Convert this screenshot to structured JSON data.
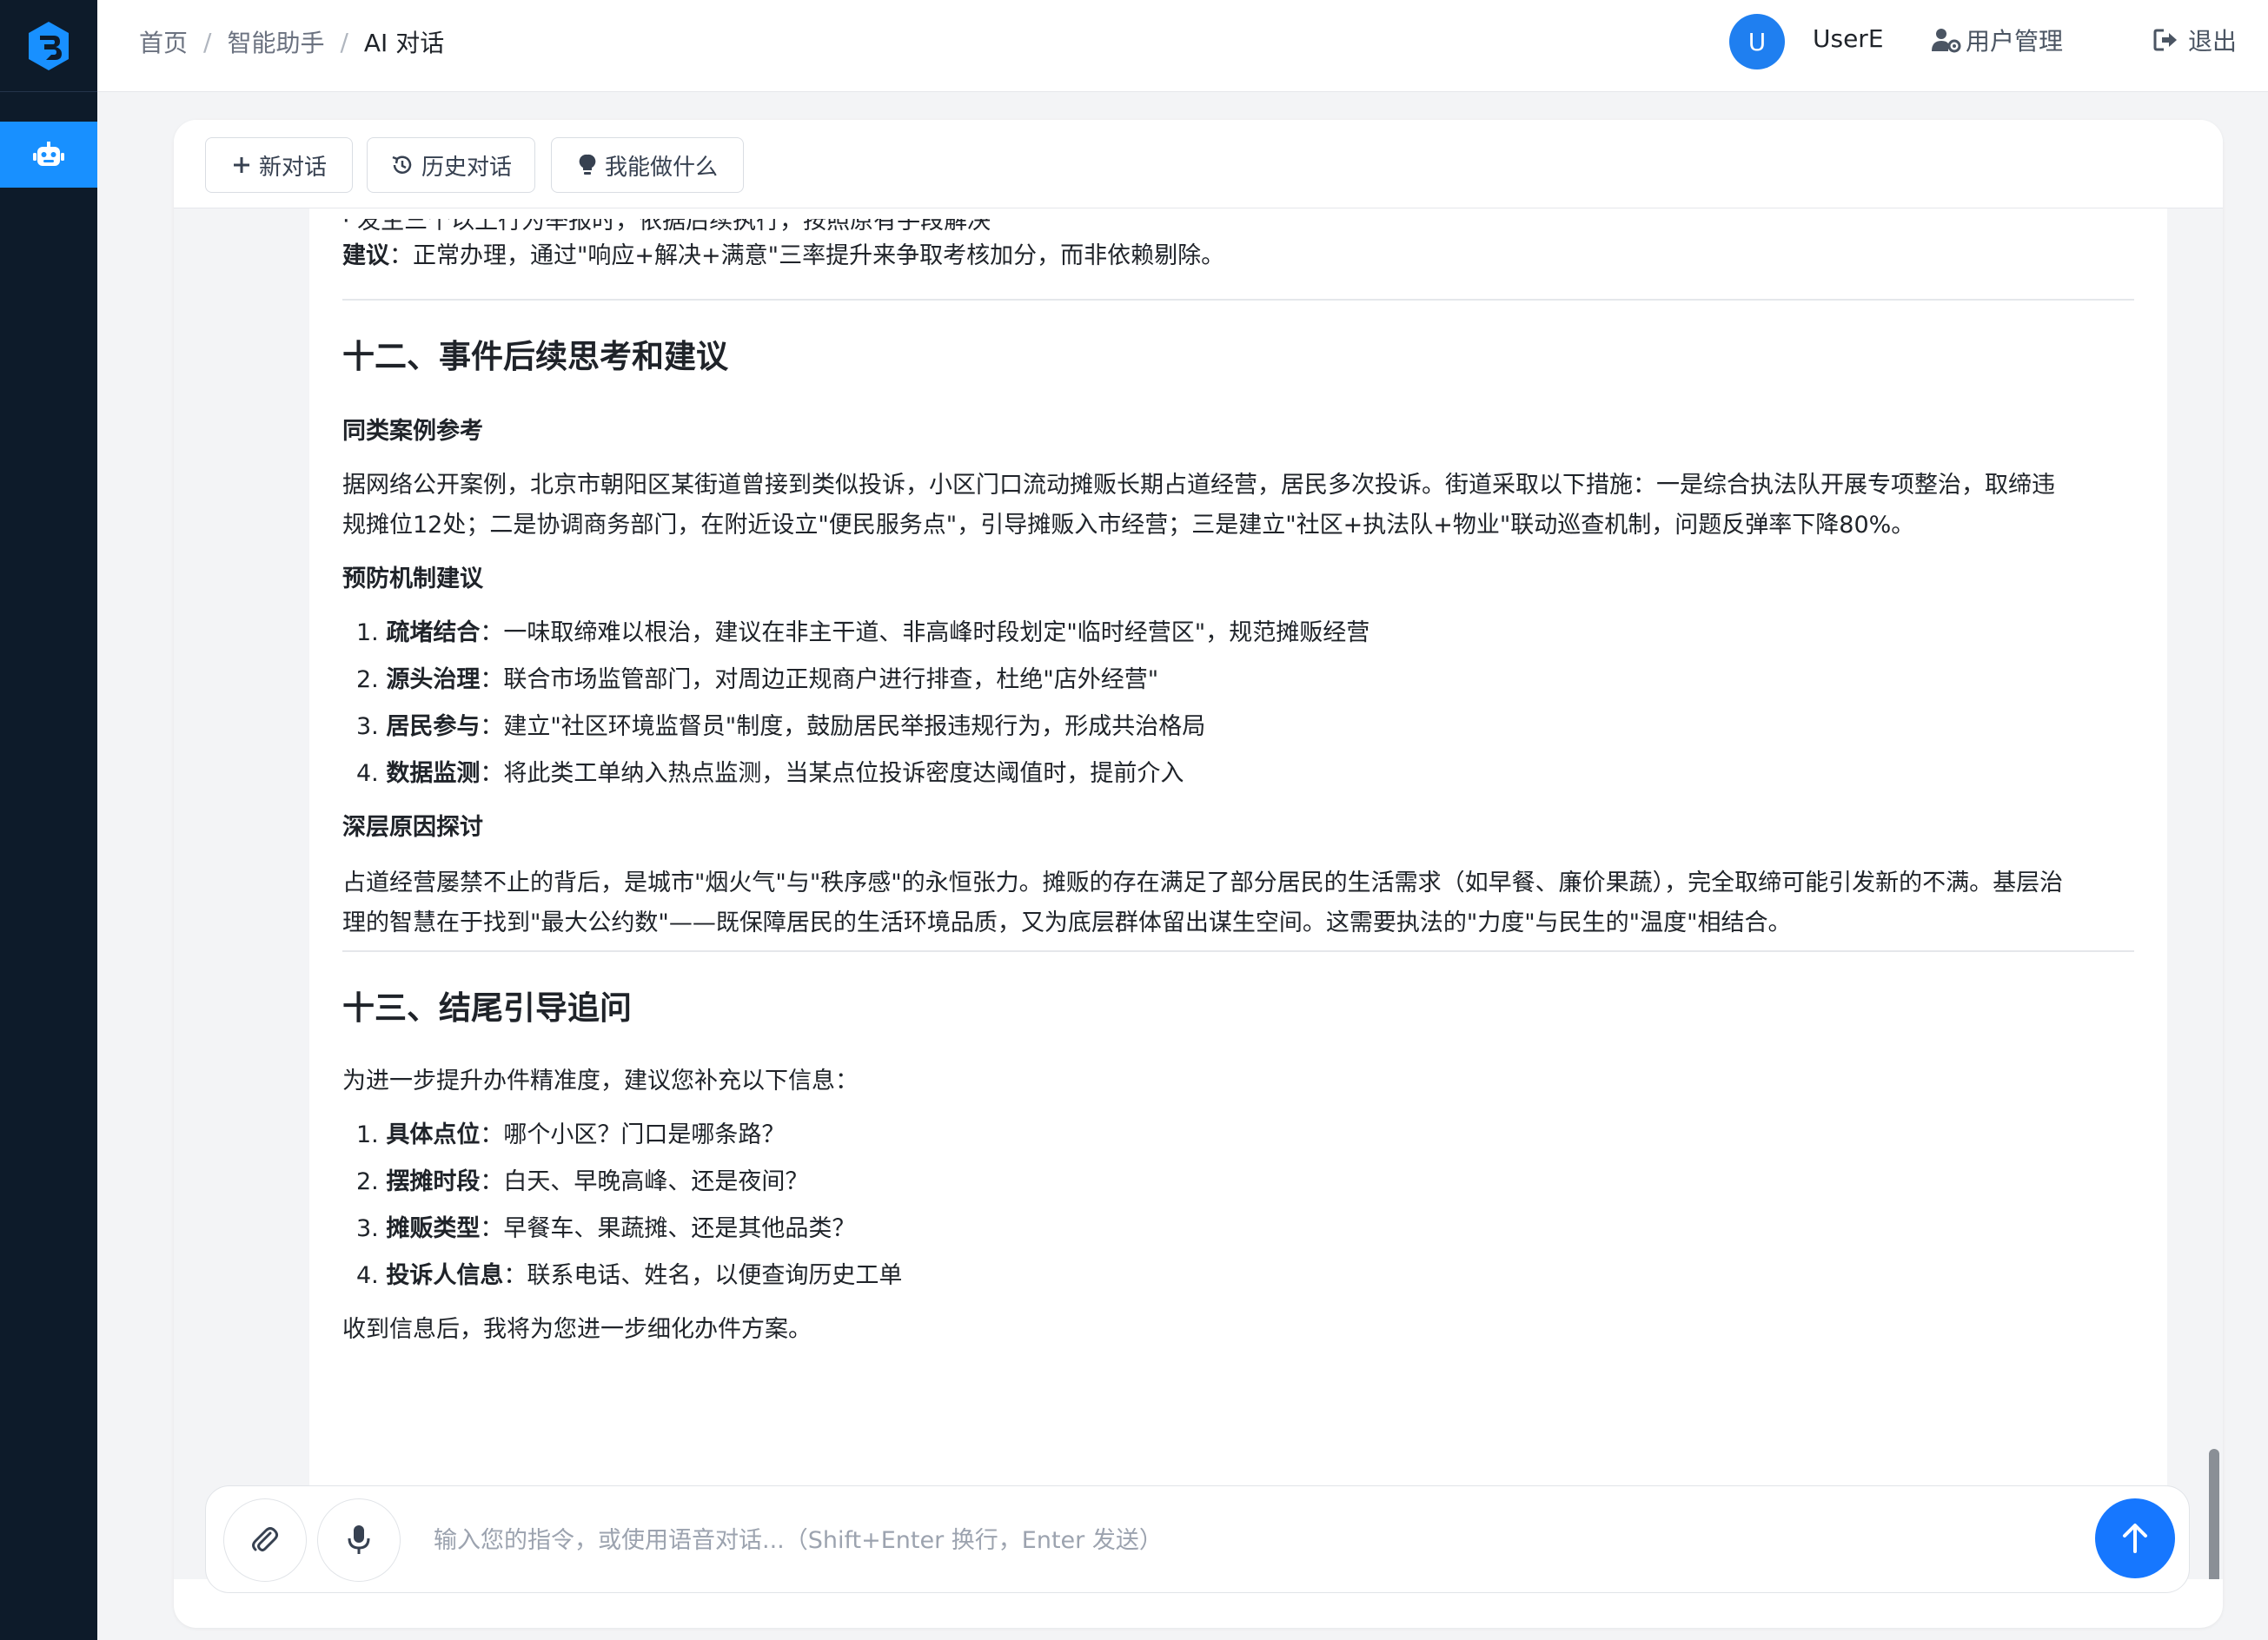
{
  "breadcrumb": [
    "首页",
    "智能助手",
    "AI 对话"
  ],
  "user": {
    "avatar_letter": "U",
    "name": "UserE",
    "manage_label": "用户管理",
    "logout_label": "退出"
  },
  "toolbar": {
    "new_chat": "新对话",
    "history": "历史对话",
    "capabilities": "我能做什么"
  },
  "message": {
    "top_cut": "· 发生三个以上行为举报时，依据后续执行，按照原有手段解决",
    "suggest_label": "建议",
    "suggest_text": "：正常办理，通过\"响应+解决+满意\"三率提升来争取考核加分，而非依赖剔除。",
    "section12_title": "十二、事件后续思考和建议",
    "case_label": "同类案例参考",
    "case_line1": "据网络公开案例，北京市朝阳区某街道曾接到类似投诉，小区门口流动摊贩长期占道经营，居民多次投诉。街道采取以下措施：一是综合执法队开展专项整治，取缔违",
    "case_line2": "规摊位12处；二是协调商务部门，在附近设立\"便民服务点\"，引导摊贩入市经营；三是建立\"社区+执法队+物业\"联动巡查机制，问题反弹率下降80%。",
    "prevent_label": "预防机制建议",
    "prevent_items": [
      {
        "num": "1.",
        "label": "疏堵结合",
        "text": "：一味取缔难以根治，建议在非主干道、非高峰时段划定\"临时经营区\"，规范摊贩经营"
      },
      {
        "num": "2.",
        "label": "源头治理",
        "text": "：联合市场监管部门，对周边正规商户进行排查，杜绝\"店外经营\""
      },
      {
        "num": "3.",
        "label": "居民参与",
        "text": "：建立\"社区环境监督员\"制度，鼓励居民举报违规行为，形成共治格局"
      },
      {
        "num": "4.",
        "label": "数据监测",
        "text": "：将此类工单纳入热点监测，当某点位投诉密度达阈值时，提前介入"
      }
    ],
    "deep_label": "深层原因探讨",
    "deep_line1": "占道经营屡禁不止的背后，是城市\"烟火气\"与\"秩序感\"的永恒张力。摊贩的存在满足了部分居民的生活需求（如早餐、廉价果蔬），完全取缔可能引发新的不满。基层治",
    "deep_line2": "理的智慧在于找到\"最大公约数\"——既保障居民的生活环境品质，又为底层群体留出谋生空间。这需要执法的\"力度\"与民生的\"温度\"相结合。",
    "section13_title": "十三、结尾引导追问",
    "followup_intro": "为进一步提升办件精准度，建议您补充以下信息：",
    "followup_items": [
      {
        "num": "1.",
        "label": "具体点位",
        "text": "：哪个小区？门口是哪条路？"
      },
      {
        "num": "2.",
        "label": "摆摊时段",
        "text": "：白天、早晚高峰、还是夜间？"
      },
      {
        "num": "3.",
        "label": "摊贩类型",
        "text": "：早餐车、果蔬摊、还是其他品类？"
      },
      {
        "num": "4.",
        "label": "投诉人信息",
        "text": "：联系电话、姓名，以便查询历史工单"
      }
    ],
    "closing": "收到信息后，我将为您进一步细化办件方案。"
  },
  "input": {
    "placeholder": "输入您的指令，或使用语音对话...（Shift+Enter 换行，Enter 发送）"
  },
  "colors": {
    "accent": "#1677ff",
    "sidebar": "#0d1b2a"
  }
}
